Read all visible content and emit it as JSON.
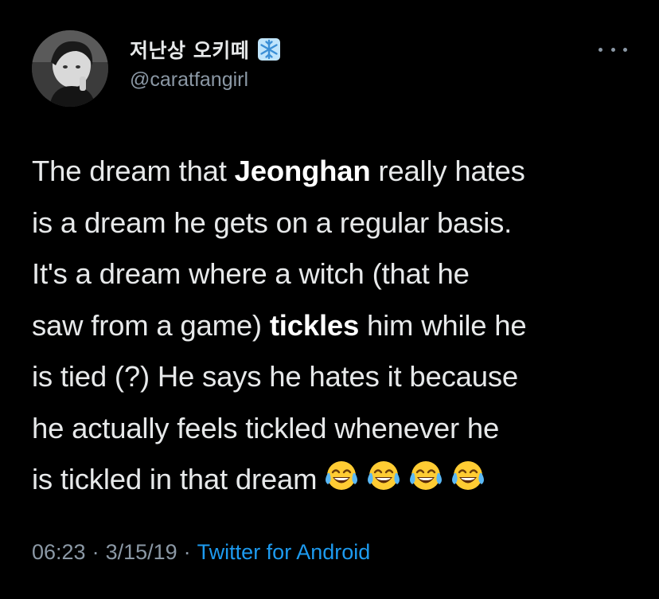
{
  "author": {
    "display_name": "저난상 오키떼",
    "handle": "@caratfangirl",
    "badge_icon": "snowflake-icon"
  },
  "tweet": {
    "lines": [
      {
        "parts": [
          {
            "text": "The dream that ",
            "bold": false
          },
          {
            "text": "Jeonghan",
            "bold": true
          },
          {
            "text": " really hates",
            "bold": false
          }
        ]
      },
      {
        "parts": [
          {
            "text": "is a dream he gets on a regular basis.",
            "bold": false
          }
        ]
      },
      {
        "parts": [
          {
            "text": "It's a dream where a witch (that he",
            "bold": false
          }
        ]
      },
      {
        "parts": [
          {
            "text": "saw from a game) ",
            "bold": false
          },
          {
            "text": "tickles",
            "bold": true
          },
          {
            "text": " him while he",
            "bold": false
          }
        ]
      },
      {
        "parts": [
          {
            "text": "is tied (?) He says he hates it because",
            "bold": false
          }
        ]
      },
      {
        "parts": [
          {
            "text": "he actually feels tickled whenever he",
            "bold": false
          }
        ]
      },
      {
        "parts": [
          {
            "text": "is tickled in that dream",
            "bold": false
          }
        ]
      }
    ],
    "emoji": [
      "face-with-tears-of-joy",
      "face-with-tears-of-joy",
      "face-with-tears-of-joy",
      "face-with-tears-of-joy"
    ]
  },
  "meta": {
    "time": "06:23",
    "separator": "·",
    "date": "3/15/19",
    "source": "Twitter for Android"
  },
  "colors": {
    "background": "#000000",
    "text": "#e7e9ea",
    "secondary": "#8b98a5",
    "link": "#1d9bf0",
    "snowflake": "#7fc8f0"
  }
}
